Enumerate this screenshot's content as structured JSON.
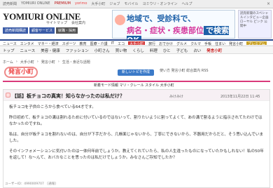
{
  "topbar": {
    "links": [
      "読売新聞",
      "YOMIURI ONLINE",
      "PREMIUM",
      "yorimo",
      "大手小町",
      "ジョブ",
      "モバイル",
      "ヨミウリ・オンライン",
      "ヘルプ"
    ],
    "close": "×"
  },
  "header": {
    "logo": "YOMIURI ONLINE",
    "sublinks": [
      "サイトマップ",
      "会社案内"
    ],
    "reg": [
      "読売新聞購読",
      "顧客サービス",
      "就職・採用"
    ]
  },
  "banner": {
    "line1": "地域で、受診科で、",
    "line2a": "病名・症状・疾患部位",
    "line2b": "で検索OK"
  },
  "sidead": {
    "text": "読売新聞のスペシャルインタビュー企画 ローヤル ピンク 公開中"
  },
  "nav1": {
    "items": [
      "ニュース",
      "エンタメ",
      "マネー・経済",
      "スポーツ",
      "教育",
      "医療・介護",
      "IT",
      "エコ",
      "大手小町",
      "旅行",
      "おでかけ",
      "グルメ",
      "クルマ",
      "手帳",
      "住まい",
      "発言小町",
      "プレミアム"
    ],
    "active": "大手小町"
  },
  "nav2": {
    "items": [
      "トップ",
      "ニュース",
      "美容・健康",
      "ファッション",
      "小町さん",
      "買い物",
      "くらし",
      "料理",
      "ひと",
      "子ども",
      "占い",
      "発言小町"
    ],
    "active": "発言小町"
  },
  "crumbs": [
    "ホーム",
    "大手小町",
    "発言小町",
    "生活・身近な話題"
  ],
  "komachi": "発言小町",
  "newbtn": "新しいトピを作成",
  "right_top": "使い方 発言小町 総合案内 RSS",
  "redbar": "新着モード情報 マリ・クレール スタイル 大手小町",
  "post": {
    "title": "【話】板チョコの真実！知らなかったのは私だけ？",
    "author": "みけみけ",
    "date": "2013年11月22日 11:45",
    "paragraphs": [
      "板チョコを子供のころから食べている64才です。",
      "昨日初めて、板チョコの溝は割れるために付いているのではないって、割りたいように割ってよくて、あの溝で割るように指示されてたわけではなかったのですね。",
      "私は、自分が板チョコを割れないのは、自分が下手だから、几帳面じゃないから、丁寧にできないから、不器用だからだと、そう思い込んでいました。",
      "そのインフォメーションに気付いたのは一体何年前でしょうか。教えてくれていたら、私の人生違ったものになっていたかもしれない！私の50年を返して！な〜んて、おバカなことを思ったのは私だけでしょうか。みなさんご存知でしたか？"
    ],
    "uid": "ユーザーID：4990009707　[通報]"
  }
}
